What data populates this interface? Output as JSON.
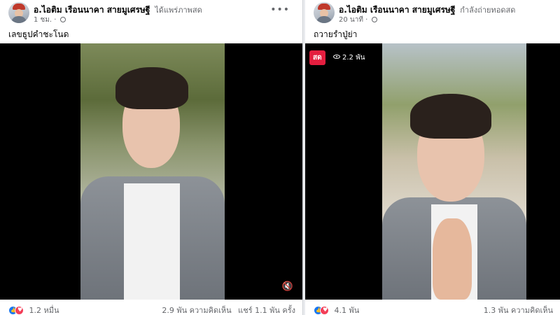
{
  "posts": [
    {
      "author": "อ.ไอติม เรือนนาคา สายมูเศรษฐี",
      "action": "ได้แพร่ภาพสด",
      "time": "1 ชม.",
      "caption": "เลขธูปคำชะโนด",
      "reaction_count": "1.2 หมื่น",
      "comments": "2.9 พัน ความคิดเห็น",
      "shares": "แชร์ 1.1 พัน ครั้ง"
    },
    {
      "author": "อ.ไอติม เรือนนาคา สายมูเศรษฐี",
      "action": "กำลังถ่ายทอดสด",
      "time": "20 นาที",
      "caption": "ถวายรำปู่ย่า",
      "live_label": "สด",
      "viewers": "2.2 พัน",
      "reaction_count": "4.1 พัน",
      "comments": "1.3 พัน ความคิดเห็น"
    }
  ],
  "more_menu": "•••",
  "mute_icon": "speaker-muted",
  "colors": {
    "live_red": "#e41e3f",
    "like_blue": "#1877f2",
    "love_red": "#f33e58"
  }
}
